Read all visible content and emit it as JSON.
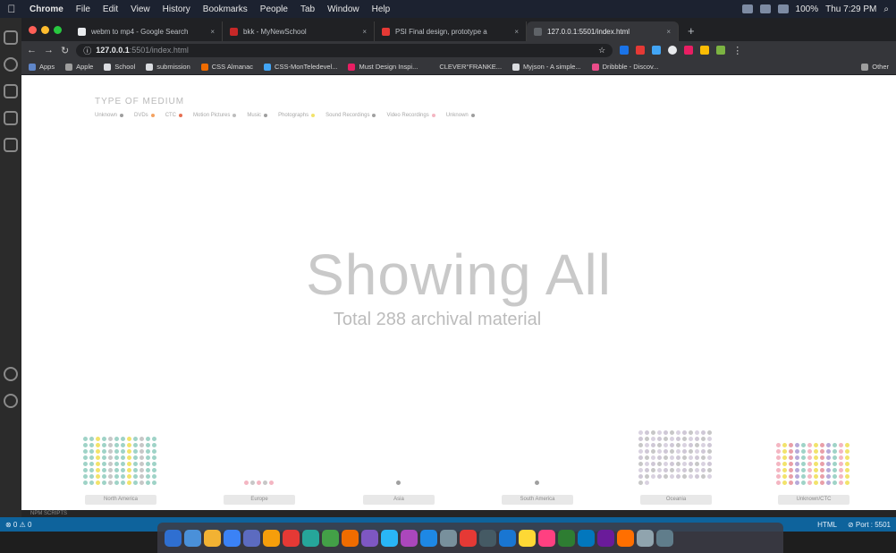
{
  "menubar": {
    "items": [
      "Chrome",
      "File",
      "Edit",
      "View",
      "History",
      "Bookmarks",
      "People",
      "Tab",
      "Window",
      "Help"
    ],
    "battery": "100%",
    "clock": "Thu 7:29 PM"
  },
  "tabs": [
    {
      "title": "webm to mp4 - Google Search",
      "color": "#e8eaed"
    },
    {
      "title": "bkk - MyNewSchool",
      "color": "#c62828"
    },
    {
      "title": "PSI Final design, prototype a",
      "color": "#e53935"
    },
    {
      "title": "127.0.0.1:5501/index.html",
      "color": "#5f6368"
    }
  ],
  "address": {
    "host": "127.0.0.1",
    "path": ":5501/index.html"
  },
  "bookmarks": [
    {
      "label": "Apps",
      "color": "#5f86c9"
    },
    {
      "label": "Apple",
      "color": "#9e9e9e"
    },
    {
      "label": "School",
      "color": "#dadce0"
    },
    {
      "label": "submission",
      "color": "#dadce0"
    },
    {
      "label": "CSS Almanac",
      "color": "#ef6c00"
    },
    {
      "label": "CSS-MonTeledevel...",
      "color": "#42a5f5"
    },
    {
      "label": "Must Design Inspi...",
      "color": "#e91e63"
    },
    {
      "label": "CLEVER°FRANKE...",
      "color": "#35363a"
    },
    {
      "label": "Myjson - A simple...",
      "color": "#dadce0"
    },
    {
      "label": "Dribbble - Discov...",
      "color": "#ea4c89"
    },
    {
      "label": "Other",
      "color": "#9e9e9e"
    }
  ],
  "page": {
    "medium_title": "TYPE OF MEDIUM",
    "legend": [
      {
        "label": "Unknown",
        "color": "#9e9e9e"
      },
      {
        "label": "DVDs",
        "color": "#f4a261"
      },
      {
        "label": "CTC",
        "color": "#e76f51"
      },
      {
        "label": "Motion Pictures",
        "color": "#bdbdbd"
      },
      {
        "label": "Music",
        "color": "#9e9e9e"
      },
      {
        "label": "Photographs",
        "color": "#f2e36b"
      },
      {
        "label": "Sound Recordings",
        "color": "#a0a0a0"
      },
      {
        "label": "Video Recordings",
        "color": "#f4b6c2"
      },
      {
        "label": "Unknown",
        "color": "#9e9e9e"
      }
    ],
    "headline": "Showing All",
    "subline": "Total 288 archival material",
    "regions": [
      {
        "label": "North America",
        "count": 96,
        "palette": [
          "#9fd3c7",
          "#9fd3c7",
          "#9fd3c7",
          "#c7c7c7",
          "#f2e36b"
        ]
      },
      {
        "label": "Europe",
        "count": 5,
        "palette": [
          "#f4b6c2",
          "#c7c7c7"
        ]
      },
      {
        "label": "Asia",
        "count": 1,
        "palette": [
          "#a0a0a0"
        ]
      },
      {
        "label": "South America",
        "count": 1,
        "palette": [
          "#a0a0a0"
        ]
      },
      {
        "label": "Oceania",
        "count": 98,
        "palette": [
          "#d9d2e0",
          "#cfc8d6",
          "#c7c7c7"
        ]
      },
      {
        "label": "Unknown/CTC",
        "count": 84,
        "palette": [
          "#f4b6c2",
          "#b7a9d9",
          "#f2e36b",
          "#9fd3c7",
          "#e99fa8"
        ]
      }
    ]
  },
  "statusbar": {
    "left": "⊗ 0 ⚠ 0",
    "lang": "HTML",
    "port": "⊘ Port : 5501"
  },
  "terminal_label": "NPM SCRIPTS"
}
